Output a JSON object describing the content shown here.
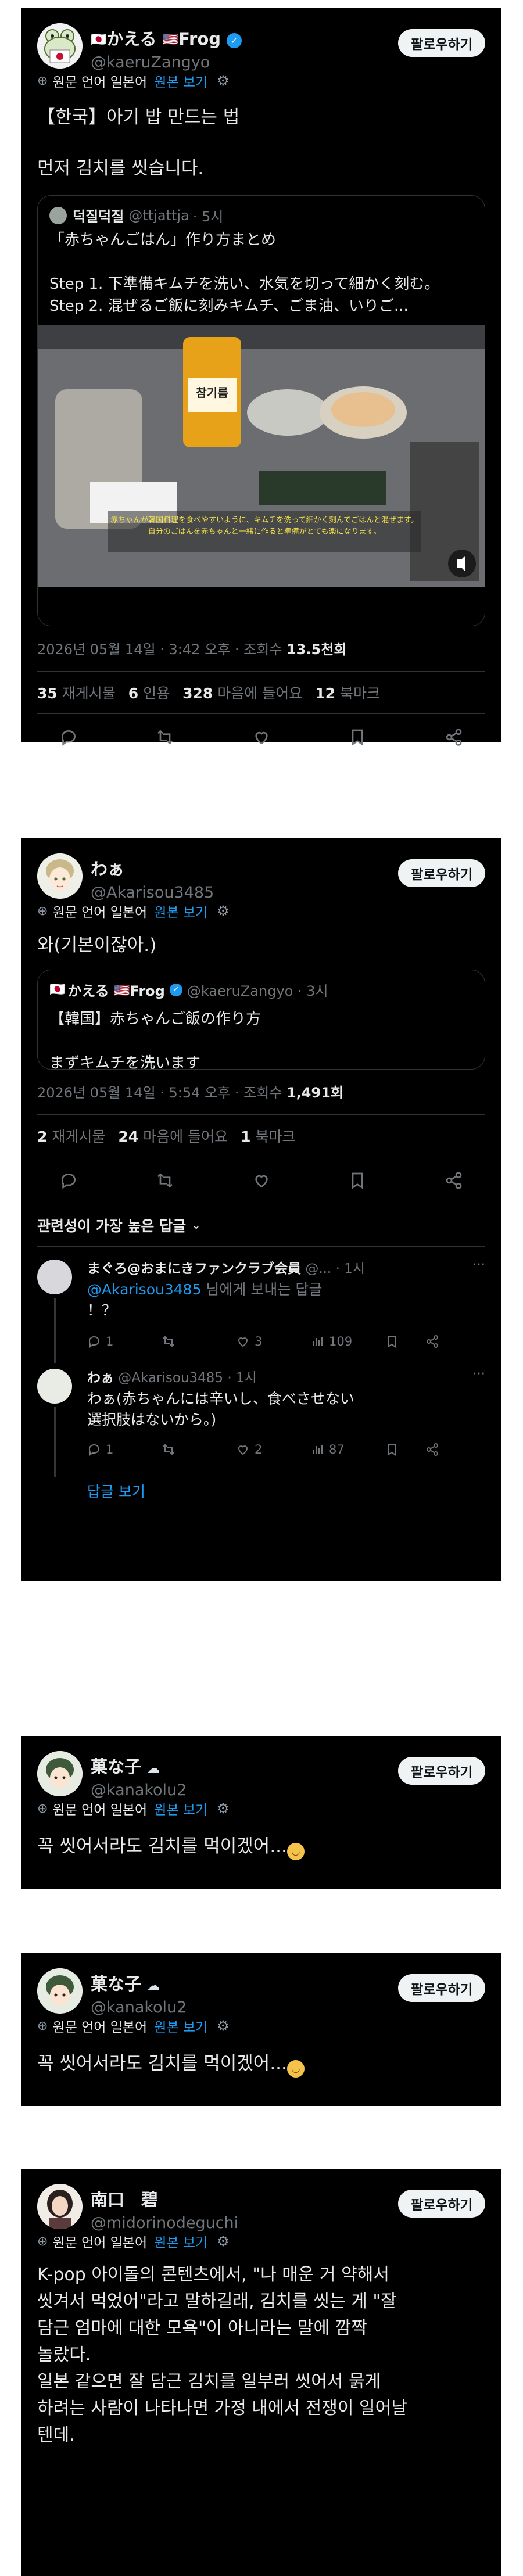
{
  "translate": {
    "label": "원문 언어 일본어",
    "link": "원본 보기"
  },
  "follow_label": "팔로우하기",
  "post1": {
    "display_name": "かえる",
    "display_name_2": "Frog",
    "username": "@kaeruZangyo",
    "body_line1": "【한국】아기 밥 만드는 법",
    "body_line2": "먼저 김치를 씻습니다.",
    "quote": {
      "name": "덕질덕질",
      "handle": "@ttjattja",
      "time": "· 5시",
      "text": "「赤ちゃんごはん」作り方まとめ\n\nStep 1. 下準備キムチを洗い、水気を切って細かく刻む。\nStep 2. 混ぜるご飯に刻みキムチ、ごま油、いりご...",
      "media_label": "참기름",
      "subtitle": "赤ちゃんが韓国料理を食べやすいように、キムチを洗って細かく刻んでごはんと混ぜます。\n自分のごはんを赤ちゃんと一緒に作ると準備がとても楽になります。"
    },
    "timestamp": "2026년 05월 14일 · 3:42 오후 · 조회수 ",
    "views": "13.5천회",
    "stats": [
      {
        "n": "35",
        "l": "재게시물"
      },
      {
        "n": "6",
        "l": "인용"
      },
      {
        "n": "328",
        "l": "마음에 들어요"
      },
      {
        "n": "12",
        "l": "북마크"
      }
    ]
  },
  "post2": {
    "display_name": "わぁ",
    "username": "@Akarisou3485",
    "body": "와(기본이잖아.)",
    "quote": {
      "name": "かえる",
      "name_2": "Frog",
      "handle": "@kaeruZangyo · 3시",
      "text": "【韓国】赤ちゃんご飯の作り方\n\nまずキムチを洗います"
    },
    "timestamp": "2026년 05월 14일 · 5:54 오후 · 조회수 ",
    "views": "1,491회",
    "stats": [
      {
        "n": "2",
        "l": "재게시물"
      },
      {
        "n": "24",
        "l": "마음에 들어요"
      },
      {
        "n": "1",
        "l": "북마크"
      }
    ],
    "sort_label": "관련성이 가장 높은 답글",
    "replies": [
      {
        "name": "まぐろ@おまにきファンクラブ会員",
        "handle": "@...",
        "time": "· 1시",
        "mention": "@Akarisou3485",
        "mention_suffix": " 님에게 보내는 답글",
        "text": "！？",
        "counts": {
          "reply": "1",
          "repost": "",
          "like": "3",
          "views": "109"
        }
      },
      {
        "name": "わぁ",
        "handle": " @Akarisou3485 · 1시",
        "text": "わぁ(赤ちゃんには辛いし、食べさせない\n選択肢はないから。)",
        "counts": {
          "reply": "1",
          "repost": "",
          "like": "2",
          "views": "87"
        }
      }
    ],
    "more_label": "답글 보기"
  },
  "post3": {
    "display_name": "菓な子",
    "username": "@kanakolu2",
    "body": "꼭 씻어서라도 김치를 먹이겠어..."
  },
  "post4": {
    "display_name": "菓な子",
    "username": "@kanakolu2",
    "body": "꼭 씻어서라도 김치를 먹이겠어..."
  },
  "post5": {
    "display_name": "南口　碧",
    "username": "@midorinodeguchi",
    "body": "K-pop 아이돌의 콘텐츠에서, \"나 매운 거 약해서\n씻겨서 먹었어\"라고 말하길래, 김치를 씻는 게 \"잘\n담근 엄마에 대한 모욕\"이 아니라는 말에 깜짝\n놀랐다.\n일본 같으면 잘 담근 김치를 일부러 씻어서 묽게\n하려는 사람이 나타나면 가정 내에서 전쟁이 일어날\n텐데."
  }
}
